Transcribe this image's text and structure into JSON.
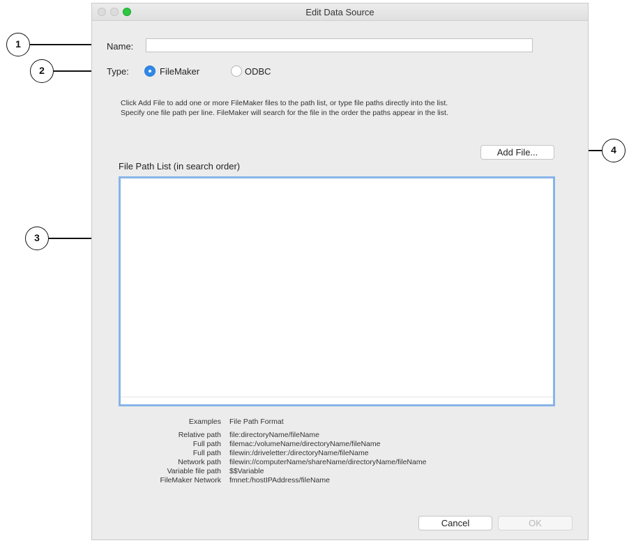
{
  "window": {
    "title": "Edit Data Source"
  },
  "form": {
    "name_label": "Name:",
    "name_value": "",
    "type_label": "Type:",
    "type_options": [
      "FileMaker",
      "ODBC"
    ],
    "type_selected": "FileMaker"
  },
  "help_text": {
    "line1": "Click Add File to add one or more FileMaker files to the path list,  or type file paths directly into the list.",
    "line2": "Specify one file path per line.  FileMaker will search for the file in the order the paths appear in the list."
  },
  "file_path_list": {
    "label": "File Path List (in search order)",
    "content": ""
  },
  "add_file_button": "Add File...",
  "examples": {
    "header_left": "Examples",
    "header_right": "File Path Format",
    "rows": [
      {
        "type": "Relative path",
        "format": "file:directoryName/fileName"
      },
      {
        "type": "Full path",
        "format": "filemac:/volumeName/directoryName/fileName"
      },
      {
        "type": "Full path",
        "format": "filewin:/driveletter:/directoryName/fileName"
      },
      {
        "type": "Network path",
        "format": "filewin://computerName/shareName/directoryName/fileName"
      },
      {
        "type": "Variable file path",
        "format": "$$Variable"
      },
      {
        "type": "FileMaker Network",
        "format": "fmnet:/hostIPAddress/fileName"
      }
    ]
  },
  "buttons": {
    "cancel": "Cancel",
    "ok": "OK",
    "ok_enabled": false
  },
  "callouts": [
    "1",
    "2",
    "3",
    "4"
  ]
}
